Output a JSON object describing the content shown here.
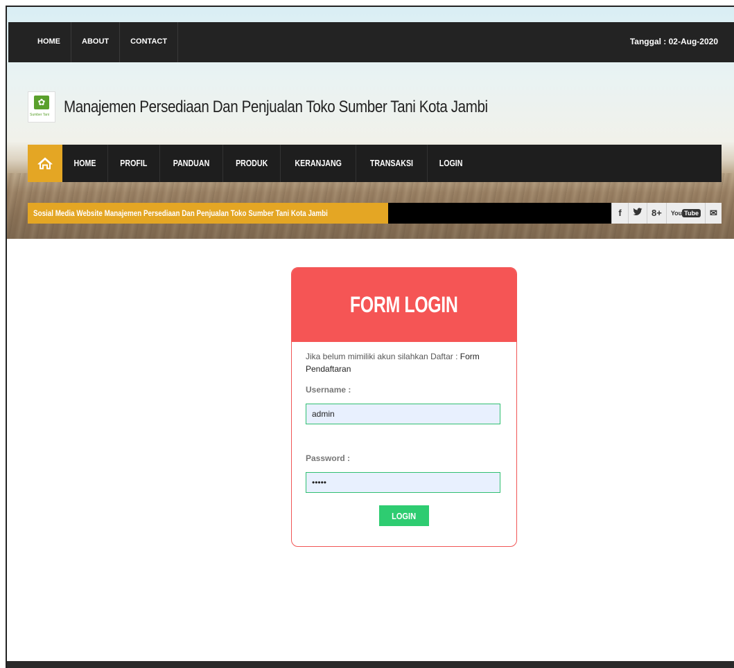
{
  "topnav": {
    "items": [
      "HOME",
      "ABOUT",
      "CONTACT"
    ],
    "date": "Tanggal : 02-Aug-2020"
  },
  "brand": {
    "logo_text": "Sumber Tani",
    "title": "Manajemen Persediaan Dan Penjualan Toko Sumber Tani Kota Jambi"
  },
  "mainnav": {
    "home_icon": "home-icon",
    "items": [
      "HOME",
      "PROFIL",
      "PANDUAN",
      "PRODUK",
      "KERANJANG",
      "TRANSAKSI",
      "LOGIN"
    ]
  },
  "ticker": {
    "label": "Sosial Media Website Manajemen Persediaan Dan Penjualan Toko Sumber Tani Kota Jambi"
  },
  "social": {
    "facebook": "f",
    "twitter": "🐦",
    "gplus": "8+",
    "youtube_you": "You",
    "youtube_tube": "Tube",
    "mail": "✉"
  },
  "login": {
    "title": "FORM LOGIN",
    "intro": "Jika belum mimiliki akun silahkan Daftar : ",
    "register_link": "Form Pendaftaran",
    "username_label": "Username :",
    "username_value": "admin",
    "password_label": "Password :",
    "password_value": "•••••",
    "button": "LOGIN"
  },
  "colors": {
    "accent": "#e4a624",
    "card_header": "#f55555",
    "button": "#2ecc71",
    "nav_dark": "#1e1e1e"
  }
}
